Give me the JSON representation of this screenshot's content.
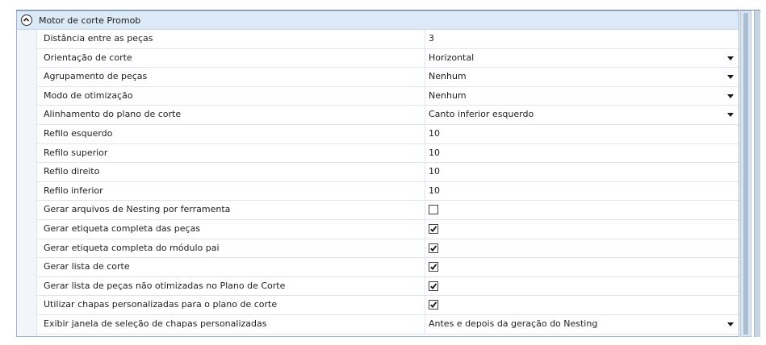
{
  "group": {
    "title": "Motor de corte Promob"
  },
  "rows": [
    {
      "label": "Distância entre as peças",
      "type": "text",
      "value": "3"
    },
    {
      "label": "Orientação de corte",
      "type": "dropdown",
      "value": "Horizontal"
    },
    {
      "label": "Agrupamento de peças",
      "type": "dropdown",
      "value": "Nenhum"
    },
    {
      "label": "Modo de otimização",
      "type": "dropdown",
      "value": "Nenhum"
    },
    {
      "label": "Alinhamento do plano de corte",
      "type": "dropdown",
      "value": "Canto inferior esquerdo"
    },
    {
      "label": "Refilo esquerdo",
      "type": "text",
      "value": "10"
    },
    {
      "label": "Refilo superior",
      "type": "text",
      "value": "10"
    },
    {
      "label": "Refilo direito",
      "type": "text",
      "value": "10"
    },
    {
      "label": "Refilo inferior",
      "type": "text",
      "value": "10"
    },
    {
      "label": "Gerar arquivos de Nesting por ferramenta",
      "type": "checkbox",
      "checked": false
    },
    {
      "label": "Gerar etiqueta completa das peças",
      "type": "checkbox",
      "checked": true
    },
    {
      "label": "Gerar etiqueta completa do módulo pai",
      "type": "checkbox",
      "checked": true
    },
    {
      "label": "Gerar lista de corte",
      "type": "checkbox",
      "checked": true
    },
    {
      "label": "Gerar lista de peças não otimizadas no Plano de Corte",
      "type": "checkbox",
      "checked": true
    },
    {
      "label": "Utilizar chapas personalizadas para o plano de corte",
      "type": "checkbox",
      "checked": true
    },
    {
      "label": "Exibir janela de seleção de chapas personalizadas",
      "type": "dropdown",
      "value": "Antes e depois da geração do Nesting"
    }
  ],
  "icons": {
    "collapse": "chevron-up-circle-icon",
    "dropdown": "caret-down-icon",
    "checkmark": "checkmark-icon"
  },
  "colors": {
    "header_bg": "#dce9f7",
    "border": "#9fb4cc",
    "grid_line": "#dde6f0"
  }
}
